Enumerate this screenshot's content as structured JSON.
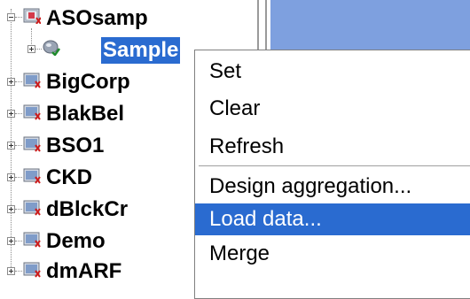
{
  "tree": {
    "root": {
      "label": "ASOsamp"
    },
    "child": {
      "label": "Sample"
    },
    "nodes": [
      {
        "label": "BigCorp"
      },
      {
        "label": "BlakBel"
      },
      {
        "label": "BSO1"
      },
      {
        "label": "CKD"
      },
      {
        "label": "dBlckCr"
      },
      {
        "label": "Demo"
      },
      {
        "label": "dmARF"
      }
    ]
  },
  "context_menu": {
    "items": [
      {
        "label": "Set"
      },
      {
        "label": "Clear"
      },
      {
        "label": "Refresh"
      },
      {
        "label": "Design aggregation..."
      },
      {
        "label": "Load data..."
      },
      {
        "label": "Merge"
      }
    ],
    "highlighted": "Load data..."
  },
  "colors": {
    "selection": "#2a6bd0",
    "pane_blue": "#7ea0df"
  }
}
